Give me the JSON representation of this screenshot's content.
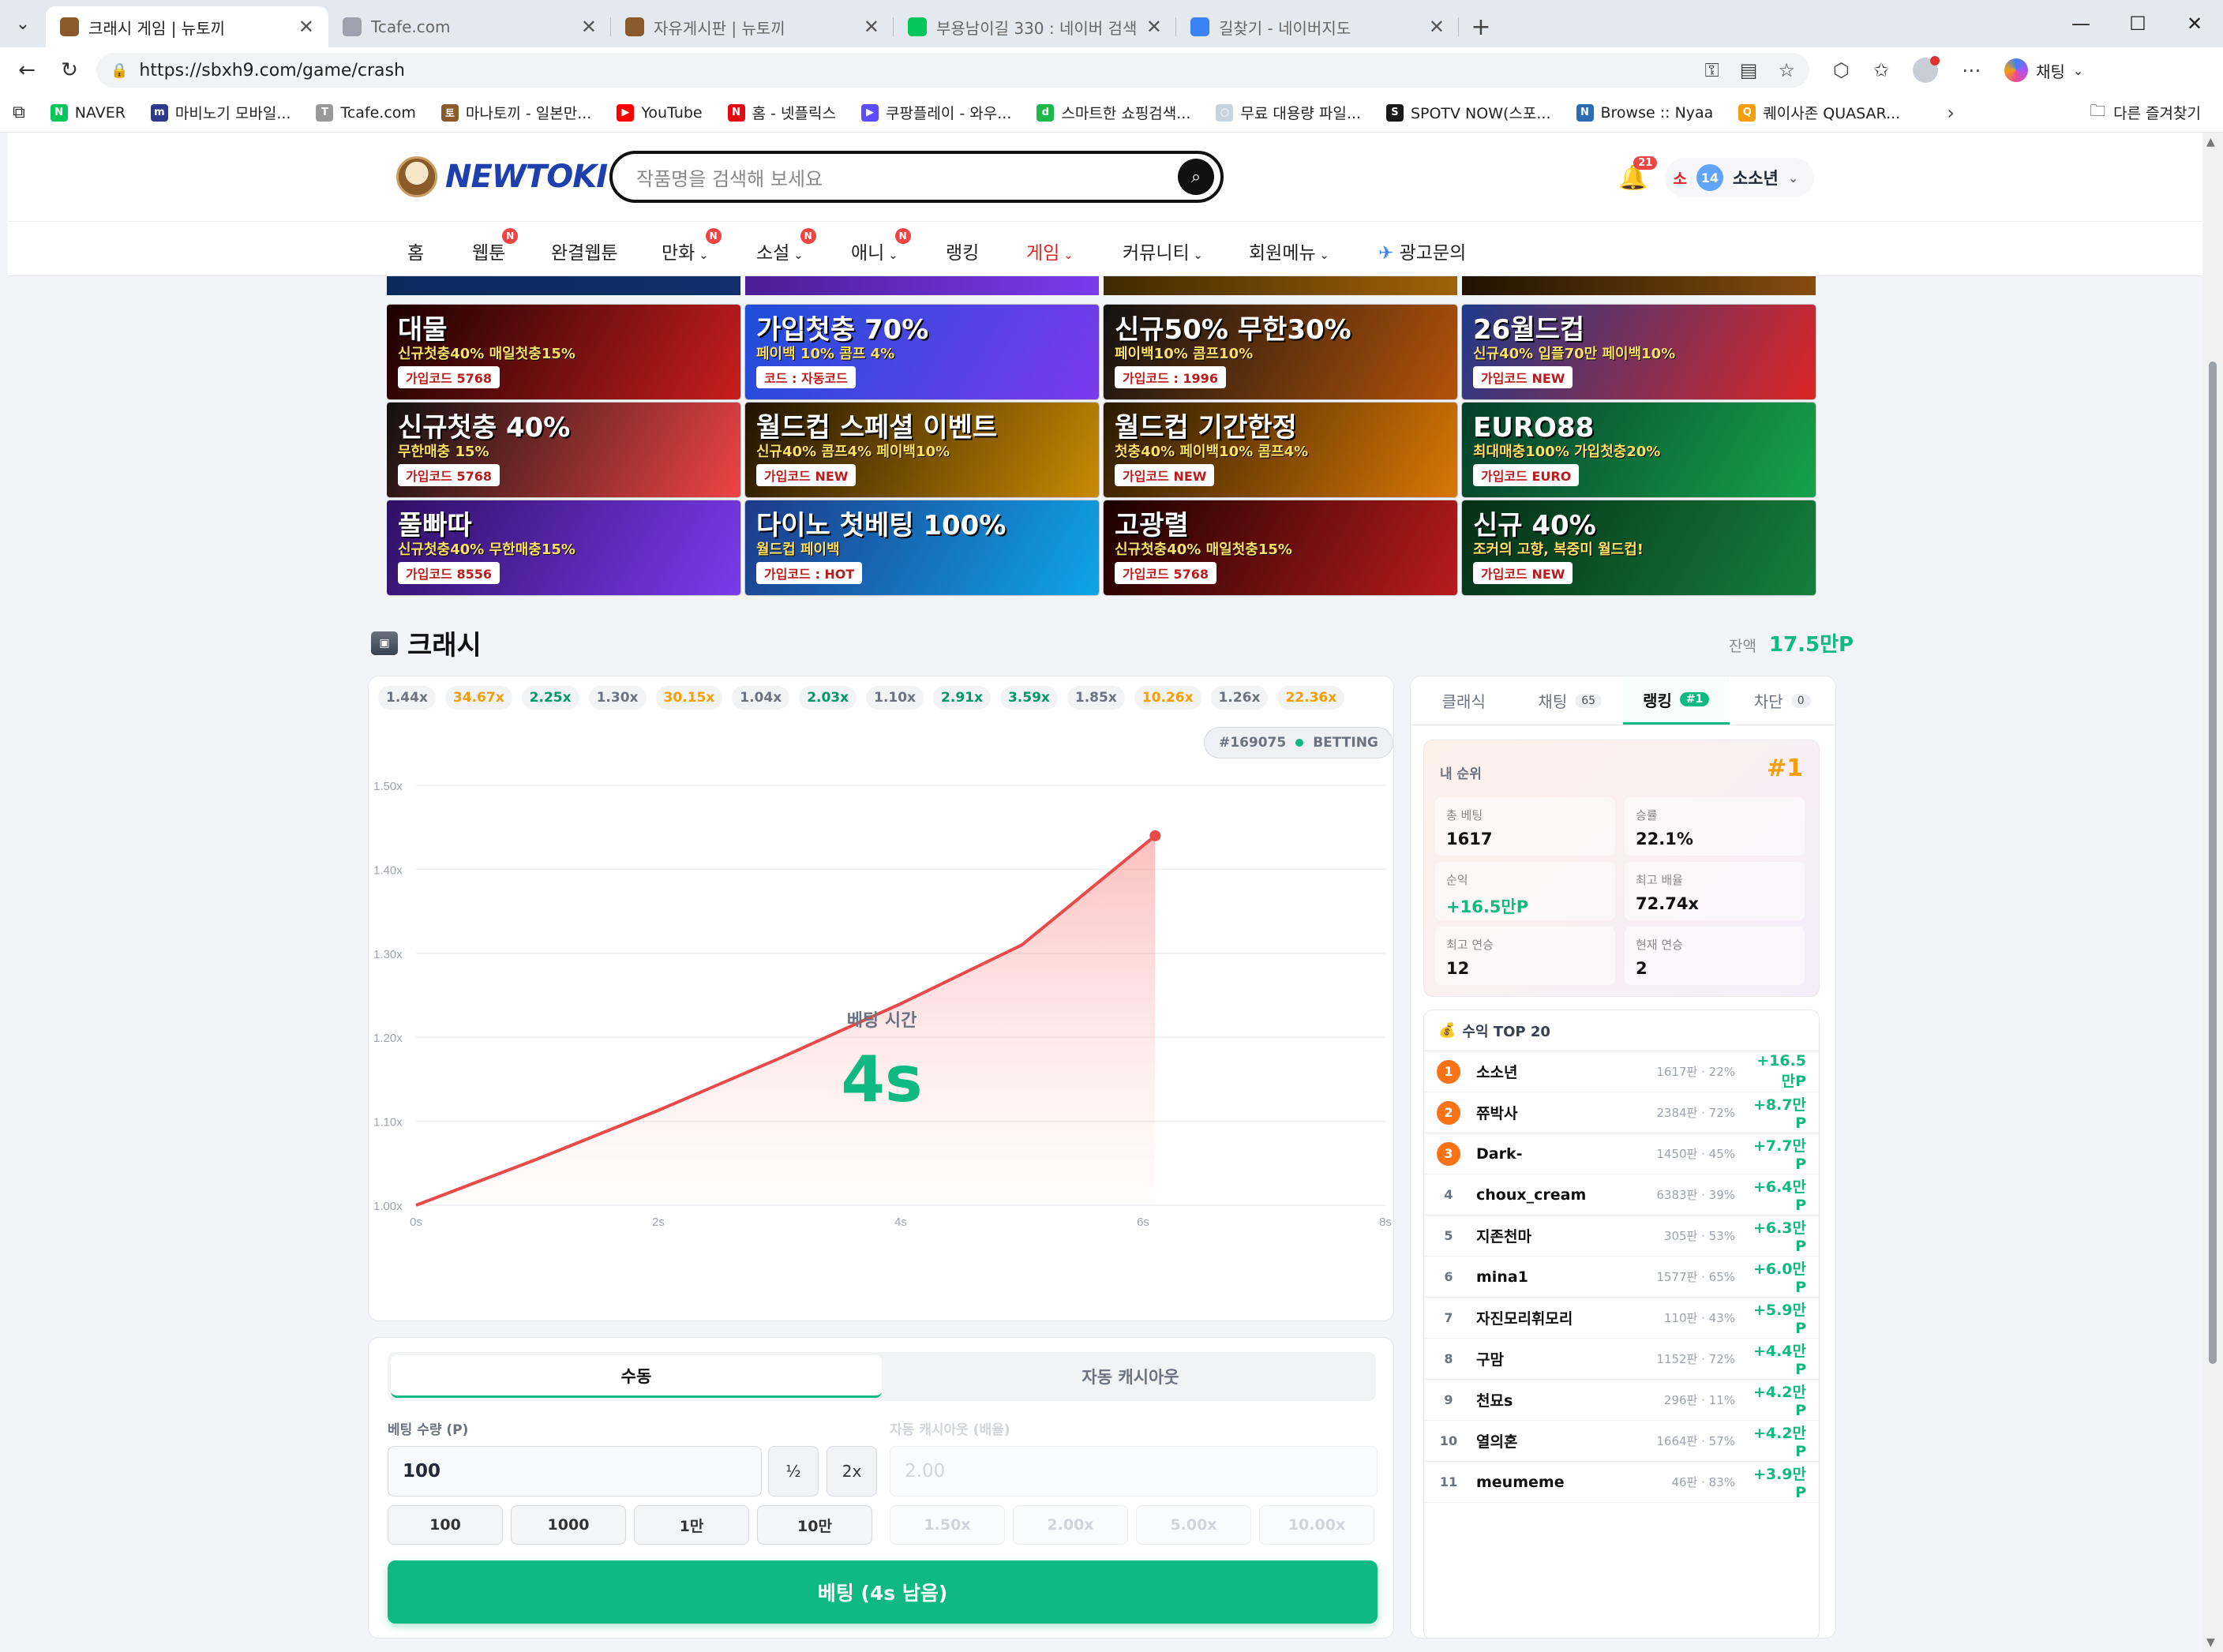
{
  "browser": {
    "tabs": [
      {
        "title": "크래시 게임 | 뉴토끼",
        "active": true,
        "color": "#8b5a2b"
      },
      {
        "title": "Tcafe.com",
        "active": false,
        "color": "#9ca3af"
      },
      {
        "title": "자유게시판 | 뉴토끼",
        "active": false,
        "color": "#8b5a2b"
      },
      {
        "title": "부용남이길 330 : 네이버 검색",
        "active": false,
        "color": "#03c75a"
      },
      {
        "title": "길찾기 - 네이버지도",
        "active": false,
        "color": "#3b82f6"
      }
    ],
    "url": "https://sbxh9.com/game/crash",
    "copilot_label": "채팅",
    "bookmarks": [
      {
        "label": "NAVER",
        "color": "#03c75a",
        "glyph": "N"
      },
      {
        "label": "마비노기 모바일...",
        "color": "#2d3a8c",
        "glyph": "m"
      },
      {
        "label": "Tcafe.com",
        "color": "#999999",
        "glyph": "T"
      },
      {
        "label": "마나토끼 - 일본만...",
        "color": "#8b5a2b",
        "glyph": "토"
      },
      {
        "label": "YouTube",
        "color": "#ff0000",
        "glyph": "▶"
      },
      {
        "label": "홈 - 넷플릭스",
        "color": "#e50914",
        "glyph": "N"
      },
      {
        "label": "쿠팡플레이 - 와우...",
        "color": "#5c4bff",
        "glyph": "▶"
      },
      {
        "label": "스마트한 쇼핑검색...",
        "color": "#1fb84a",
        "glyph": "d"
      },
      {
        "label": "무료 대용량 파일...",
        "color": "#c8d3df",
        "glyph": "○"
      },
      {
        "label": "SPOTV NOW(스포...",
        "color": "#1a1a1a",
        "glyph": "S"
      },
      {
        "label": "Browse :: Nyaa",
        "color": "#2f6db3",
        "glyph": "N"
      },
      {
        "label": "퀘이사존 QUASAR...",
        "color": "#f59e0b",
        "glyph": "Q"
      }
    ],
    "other_bookmarks": "다른 즐겨찾기"
  },
  "site": {
    "logo_text": "NEWTOKI",
    "search_placeholder": "작품명을 검색해 보세요",
    "notif_count": "21",
    "user_prefix": "소",
    "user_level": "14",
    "user_name": "소소년",
    "nav": [
      {
        "label": "홈",
        "badge": false,
        "caret": false,
        "active": false
      },
      {
        "label": "웹툰",
        "badge": true,
        "caret": false,
        "active": false
      },
      {
        "label": "완결웹툰",
        "badge": false,
        "caret": false,
        "active": false
      },
      {
        "label": "만화",
        "badge": true,
        "caret": true,
        "active": false
      },
      {
        "label": "소설",
        "badge": true,
        "caret": true,
        "active": false
      },
      {
        "label": "애니",
        "badge": true,
        "caret": true,
        "active": false
      },
      {
        "label": "랭킹",
        "badge": false,
        "caret": false,
        "active": false
      },
      {
        "label": "게임",
        "badge": false,
        "caret": true,
        "active": true
      },
      {
        "label": "커뮤니티",
        "badge": false,
        "caret": true,
        "active": false
      },
      {
        "label": "회원메뉴",
        "badge": false,
        "caret": true,
        "active": false
      },
      {
        "label": "광고문의",
        "badge": false,
        "caret": false,
        "active": false
      }
    ]
  },
  "banners": [
    {
      "main": "대물",
      "sub": "신규첫충40% 매일첫충15%",
      "code": "가입코드 5768",
      "bg": "#1a0000",
      "accent": "#c81e1e"
    },
    {
      "main": "가입첫충 70%",
      "sub": "페이백 10% 콤프 4%",
      "code": "코드 : 자동코드",
      "bg": "#1d4ed8",
      "accent": "#7c3aed"
    },
    {
      "main": "신규50% 무한30%",
      "sub": "페이백10% 콤프10%",
      "code": "가입코드 : 1996",
      "bg": "#111111",
      "accent": "#b45309"
    },
    {
      "main": "26월드컵",
      "sub": "신규40% 입플70만 페이백10%",
      "code": "가입코드 NEW",
      "bg": "#1e3a8a",
      "accent": "#dc2626"
    },
    {
      "main": "신규첫충 40%",
      "sub": "무한매충 15%",
      "code": "가입코드 5768",
      "bg": "#111111",
      "accent": "#ef4444"
    },
    {
      "main": "월드컵 스페셜 이벤트",
      "sub": "신규40% 콤프4% 페이백10%",
      "code": "가입코드 NEW",
      "bg": "#1f1300",
      "accent": "#ca8a04"
    },
    {
      "main": "월드컵 기간한정",
      "sub": "첫충40% 페이백10% 콤프4%",
      "code": "가입코드 NEW",
      "bg": "#2a1a00",
      "accent": "#d97706"
    },
    {
      "main": "EURO88",
      "sub": "최대매충100% 가입첫충20%",
      "code": "가입코드 EURO",
      "bg": "#053d2b",
      "accent": "#16a34a"
    },
    {
      "main": "풀빠따",
      "sub": "신규첫충40% 무한매충15%",
      "code": "가입코드 8556",
      "bg": "#2e1065",
      "accent": "#7c3aed"
    },
    {
      "main": "다이노 첫베팅 100%",
      "sub": "월드컵 페이백",
      "code": "가입코드 : HOT",
      "bg": "#1e3a8a",
      "accent": "#0ea5e9"
    },
    {
      "main": "고광렬",
      "sub": "신규첫충40% 매일첫충15%",
      "code": "가입코드 5768",
      "bg": "#1a0000",
      "accent": "#b91c1c"
    },
    {
      "main": "신규 40%",
      "sub": "조커의 고향, 복중미 월드컵!",
      "code": "가입코드 NEW",
      "bg": "#052e16",
      "accent": "#15803d"
    }
  ],
  "game": {
    "title": "크래시",
    "balance_label": "잔액",
    "balance_value": "17.5만P",
    "history": [
      {
        "v": "1.44x",
        "c": "#6b7280"
      },
      {
        "v": "34.67x",
        "c": "#f59e0b"
      },
      {
        "v": "2.25x",
        "c": "#059669"
      },
      {
        "v": "1.30x",
        "c": "#6b7280"
      },
      {
        "v": "30.15x",
        "c": "#f59e0b"
      },
      {
        "v": "1.04x",
        "c": "#6b7280"
      },
      {
        "v": "2.03x",
        "c": "#059669"
      },
      {
        "v": "1.10x",
        "c": "#6b7280"
      },
      {
        "v": "2.91x",
        "c": "#059669"
      },
      {
        "v": "3.59x",
        "c": "#059669"
      },
      {
        "v": "1.85x",
        "c": "#6b7280"
      },
      {
        "v": "10.26x",
        "c": "#f59e0b"
      },
      {
        "v": "1.26x",
        "c": "#6b7280"
      },
      {
        "v": "22.36x",
        "c": "#f59e0b"
      }
    ],
    "round_id": "#169075",
    "round_status": "BETTING",
    "countdown_label": "베팅 시간",
    "countdown_value": "4s"
  },
  "chart_data": {
    "type": "line",
    "title": "",
    "xlabel": "",
    "ylabel": "",
    "x_ticks": [
      "0s",
      "2s",
      "4s",
      "6s",
      "8s"
    ],
    "y_ticks": [
      "1.00x",
      "1.10x",
      "1.20x",
      "1.30x",
      "1.40x",
      "1.50x"
    ],
    "xlim": [
      0,
      8
    ],
    "ylim": [
      1.0,
      1.5
    ],
    "series": [
      {
        "x": [
          0,
          1,
          2,
          3,
          4,
          5,
          6.1
        ],
        "y": [
          1.0,
          1.055,
          1.113,
          1.175,
          1.24,
          1.31,
          1.44
        ]
      }
    ],
    "line_color": "#e84a4a",
    "grid": true
  },
  "bet": {
    "mode_tabs": [
      "수동",
      "자동 캐시아웃"
    ],
    "amount_label": "베팅 수량 (P)",
    "amount_value": "100",
    "half_label": "½",
    "double_label": "2x",
    "quick": [
      "100",
      "1000",
      "1만",
      "10만"
    ],
    "auto_label": "자동 캐시아웃 (배율)",
    "auto_placeholder": "2.00",
    "auto_quick": [
      "1.50x",
      "2.00x",
      "5.00x",
      "10.00x"
    ],
    "submit_label": "베팅 (4s 남음)"
  },
  "side": {
    "tabs": [
      {
        "label": "클래식",
        "count": "",
        "active": false
      },
      {
        "label": "채팅",
        "count": "65",
        "active": false
      },
      {
        "label": "랭킹",
        "count": "#1",
        "active": true
      },
      {
        "label": "차단",
        "count": "0",
        "active": false
      }
    ],
    "myrank_label": "내 순위",
    "myrank_value": "#1",
    "stats": [
      {
        "label": "총 베팅",
        "value": "1617",
        "green": false
      },
      {
        "label": "승률",
        "value": "22.1%",
        "green": false
      },
      {
        "label": "순익",
        "value": "+16.5만P",
        "green": true
      },
      {
        "label": "최고 배율",
        "value": "72.74x",
        "green": false
      },
      {
        "label": "최고 연승",
        "value": "12",
        "green": false
      },
      {
        "label": "현재 연승",
        "value": "2",
        "green": false
      }
    ],
    "top_title": "수익 TOP 20",
    "top": [
      {
        "rank": "1",
        "name": "소소년",
        "meta": "1617판 · 22%",
        "profit": "+16.5만P"
      },
      {
        "rank": "2",
        "name": "쮸박사",
        "meta": "2384판 · 72%",
        "profit": "+8.7만P"
      },
      {
        "rank": "3",
        "name": "Dark-",
        "meta": "1450판 · 45%",
        "profit": "+7.7만P"
      },
      {
        "rank": "4",
        "name": "choux_cream",
        "meta": "6383판 · 39%",
        "profit": "+6.4만P"
      },
      {
        "rank": "5",
        "name": "지존천마",
        "meta": "305판 · 53%",
        "profit": "+6.3만P"
      },
      {
        "rank": "6",
        "name": "mina1",
        "meta": "1577판 · 65%",
        "profit": "+6.0만P"
      },
      {
        "rank": "7",
        "name": "자진모리휘모리",
        "meta": "110판 · 43%",
        "profit": "+5.9만P"
      },
      {
        "rank": "8",
        "name": "구맘",
        "meta": "1152판 · 72%",
        "profit": "+4.4만P"
      },
      {
        "rank": "9",
        "name": "천묘s",
        "meta": "296판 · 11%",
        "profit": "+4.2만P"
      },
      {
        "rank": "10",
        "name": "열의혼",
        "meta": "1664판 · 57%",
        "profit": "+4.2만P"
      },
      {
        "rank": "11",
        "name": "meumeme",
        "meta": "46판 · 83%",
        "profit": "+3.9만P"
      }
    ]
  }
}
